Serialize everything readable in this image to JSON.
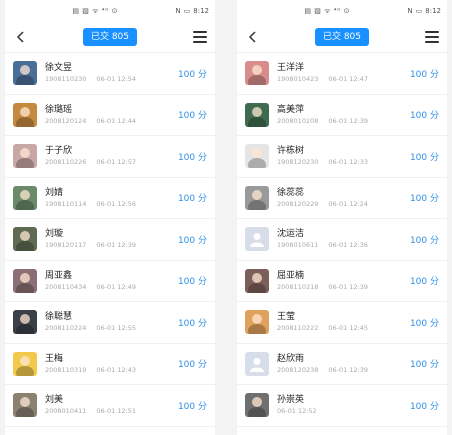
{
  "status": {
    "icons_left": "▤ ▧ ᯤ ⁴ᴳ ⊙",
    "time": "8:12",
    "battery": "▭",
    "nfc": "N"
  },
  "header": {
    "badge": "已交 805"
  },
  "left": {
    "items": [
      {
        "name": "徐文昱",
        "id": "1908110230",
        "time": "06-01 12:54",
        "score": "100 分",
        "avatar": "#4a6e9a"
      },
      {
        "name": "徐璐瑶",
        "id": "2008120124",
        "time": "06-01 12:44",
        "score": "100 分",
        "avatar": "#c58a3f"
      },
      {
        "name": "于子欣",
        "id": "2008110226",
        "time": "06-01 12:57",
        "score": "100 分",
        "avatar": "#c9a7a7"
      },
      {
        "name": "刘婧",
        "id": "1908110114",
        "time": "06-01 12:56",
        "score": "100 分",
        "avatar": "#6b8a6a"
      },
      {
        "name": "刘璇",
        "id": "1908120117",
        "time": "06-01 12:39",
        "score": "100 分",
        "avatar": "#5f6b53"
      },
      {
        "name": "周亚鑫",
        "id": "2008110434",
        "time": "06-01 12:49",
        "score": "100 分",
        "avatar": "#8b6f74"
      },
      {
        "name": "徐聪慧",
        "id": "2008110224",
        "time": "06-01 12:55",
        "score": "100 分",
        "avatar": "#3a3f48"
      },
      {
        "name": "王梅",
        "id": "2008110319",
        "time": "06-01 12:43",
        "score": "100 分",
        "avatar": "#f2c94c"
      },
      {
        "name": "刘美",
        "id": "2008010411",
        "time": "06-01 12:51",
        "score": "100 分",
        "avatar": "#8a8170"
      }
    ]
  },
  "right": {
    "items": [
      {
        "name": "王洋洋",
        "id": "1908010423",
        "time": "06-01 12:47",
        "score": "100 分",
        "avatar": "#d98c8c"
      },
      {
        "name": "高美萍",
        "id": "2008010208",
        "time": "06-01 12:39",
        "score": "100 分",
        "avatar": "#3f6b4f"
      },
      {
        "name": "许栋树",
        "id": "1908120230",
        "time": "06-01 12:33",
        "score": "100 分",
        "avatar": "#e5e5e5"
      },
      {
        "name": "徐蕊蕊",
        "id": "2008120229",
        "time": "06-01 12:24",
        "score": "100 分",
        "avatar": "#9a9a9a"
      },
      {
        "name": "沈运洁",
        "id": "1908010611",
        "time": "06-01 12:36",
        "score": "100 分",
        "avatar": "placeholder"
      },
      {
        "name": "屈亚楠",
        "id": "2008110218",
        "time": "06-01 12:39",
        "score": "100 分",
        "avatar": "#7c5f5a"
      },
      {
        "name": "王莹",
        "id": "2008110222",
        "time": "06-01 12:45",
        "score": "100 分",
        "avatar": "#e0a15c"
      },
      {
        "name": "赵欣雨",
        "id": "2008120238",
        "time": "06-01 12:39",
        "score": "100 分",
        "avatar": "placeholder"
      },
      {
        "name": "孙崇英",
        "id": "",
        "time": "06-01 12:52",
        "score": "100 分",
        "avatar": "#6f6f6f"
      }
    ]
  }
}
